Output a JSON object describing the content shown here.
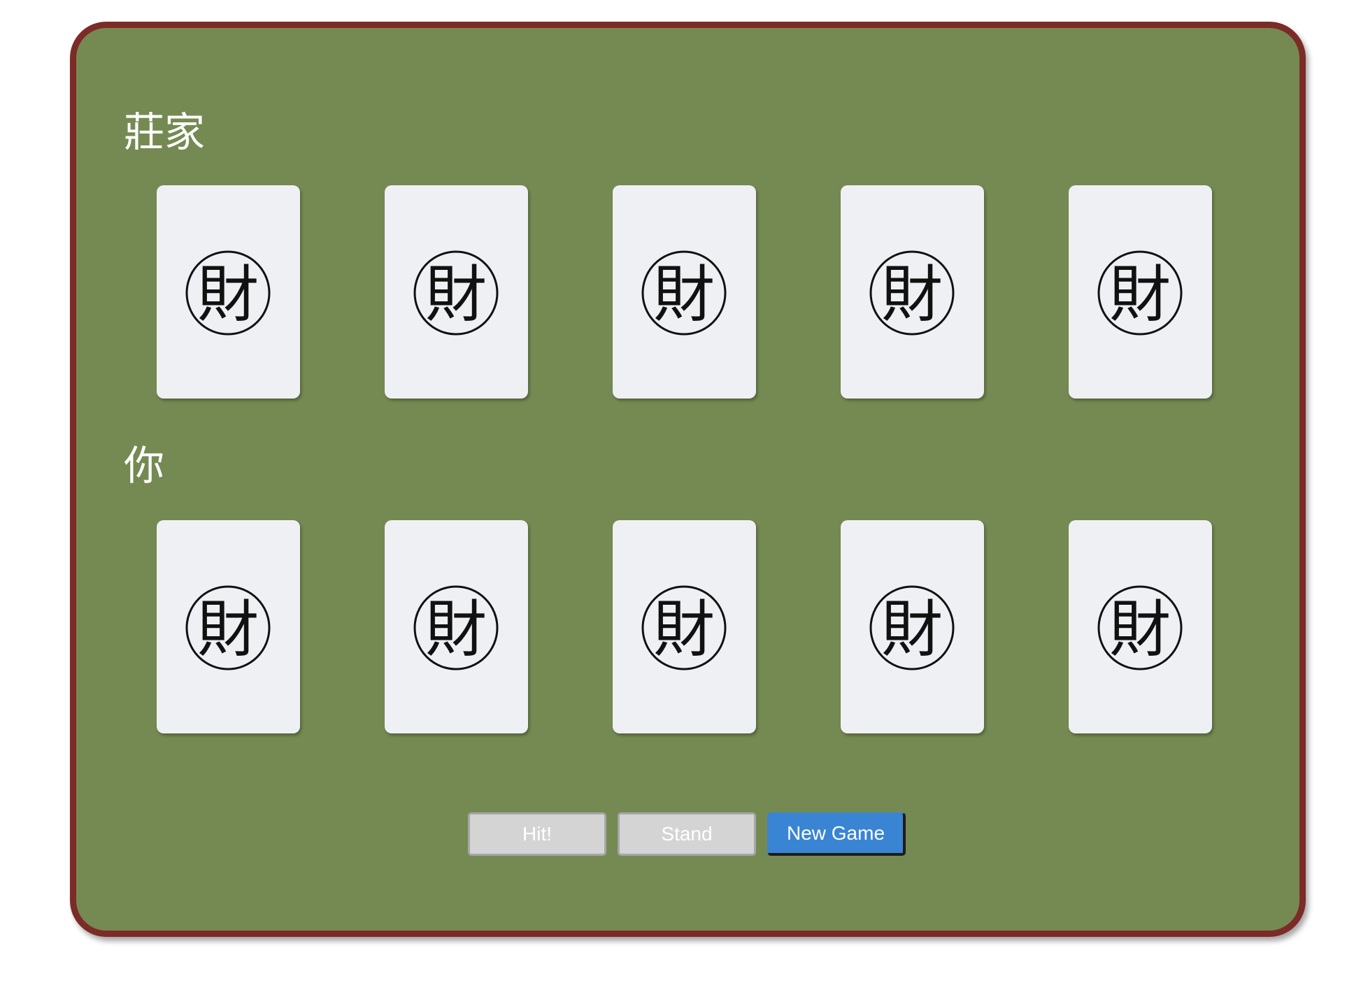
{
  "table": {
    "felt_color": "#758a52",
    "border_color": "#7c2b26"
  },
  "dealer": {
    "label": "莊家",
    "cards": [
      {
        "face": "down",
        "emblem": "財"
      },
      {
        "face": "down",
        "emblem": "財"
      },
      {
        "face": "down",
        "emblem": "財"
      },
      {
        "face": "down",
        "emblem": "財"
      },
      {
        "face": "down",
        "emblem": "財"
      }
    ]
  },
  "player": {
    "label": "你",
    "cards": [
      {
        "face": "down",
        "emblem": "財"
      },
      {
        "face": "down",
        "emblem": "財"
      },
      {
        "face": "down",
        "emblem": "財"
      },
      {
        "face": "down",
        "emblem": "財"
      },
      {
        "face": "down",
        "emblem": "財"
      }
    ]
  },
  "controls": {
    "hit_label": "Hit!",
    "hit_enabled": false,
    "stand_label": "Stand",
    "stand_enabled": false,
    "new_game_label": "New Game",
    "new_game_enabled": true,
    "new_game_color": "#3a84d4"
  }
}
